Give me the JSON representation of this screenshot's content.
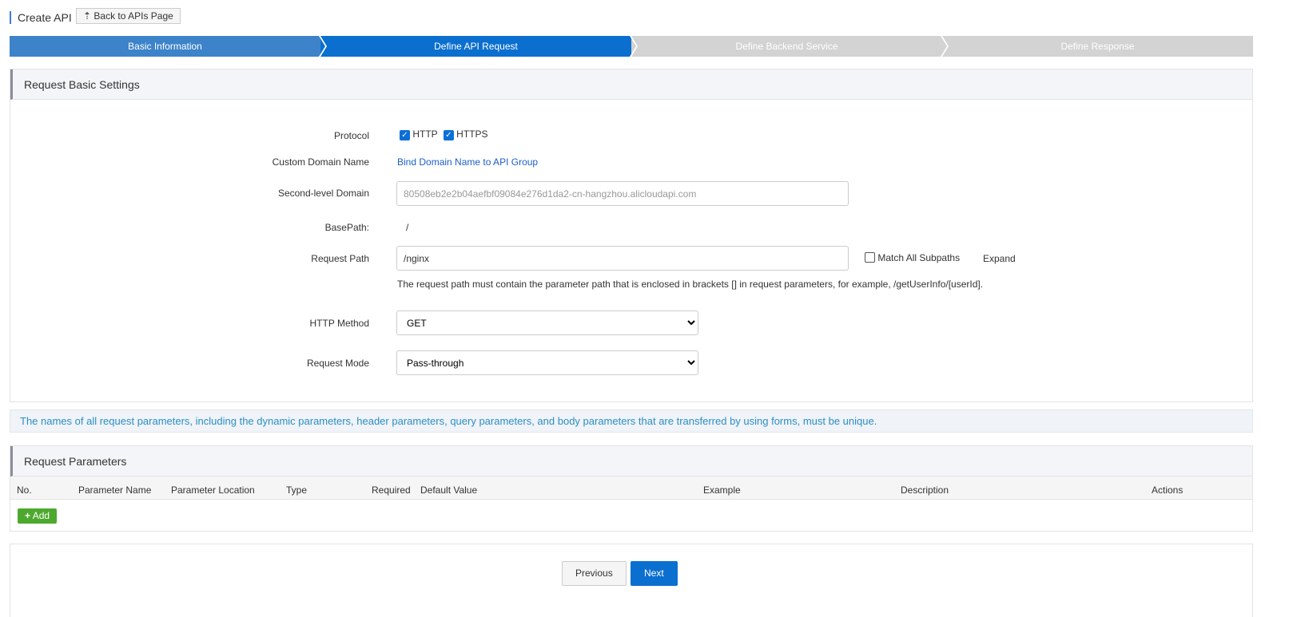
{
  "header": {
    "title": "Create API",
    "back_label": "Back to APIs Page"
  },
  "steps": [
    {
      "label": "Basic Information",
      "color": "#3d83c9"
    },
    {
      "label": "Define API Request",
      "color": "#0b6fcf"
    },
    {
      "label": "Define Backend Service",
      "color": "#d3d3d3"
    },
    {
      "label": "Define Response",
      "color": "#d3d3d3"
    }
  ],
  "basic": {
    "heading": "Request Basic Settings",
    "protocol_label": "Protocol",
    "http": "HTTP",
    "https": "HTTPS",
    "custom_domain_label": "Custom Domain Name",
    "custom_domain_link": "Bind Domain Name to API Group",
    "second_domain_label": "Second-level Domain",
    "second_domain_value": "80508eb2e2b04aefbf09084e276d1da2-cn-hangzhou.alicloudapi.com",
    "basepath_label": "BasePath:",
    "basepath_value": "/",
    "path_label": "Request Path",
    "path_value": "/nginx",
    "match_all": "Match All Subpaths",
    "expand": "Expand",
    "path_hint": "The request path must contain the parameter path that is enclosed in brackets [] in request parameters, for example, /getUserInfo/[userId].",
    "method_label": "HTTP Method",
    "method_value": "GET",
    "mode_label": "Request Mode",
    "mode_value": "Pass-through"
  },
  "notice": "The names of all request parameters, including the dynamic parameters, header parameters, query parameters, and body parameters that are transferred by using forms, must be unique.",
  "params": {
    "heading": "Request Parameters",
    "columns": [
      "No.",
      "Parameter Name",
      "Parameter Location",
      "Type",
      "Required",
      "Default Value",
      "Example",
      "Description",
      "Actions"
    ],
    "add_label": "Add"
  },
  "footer": {
    "previous": "Previous",
    "next": "Next"
  }
}
